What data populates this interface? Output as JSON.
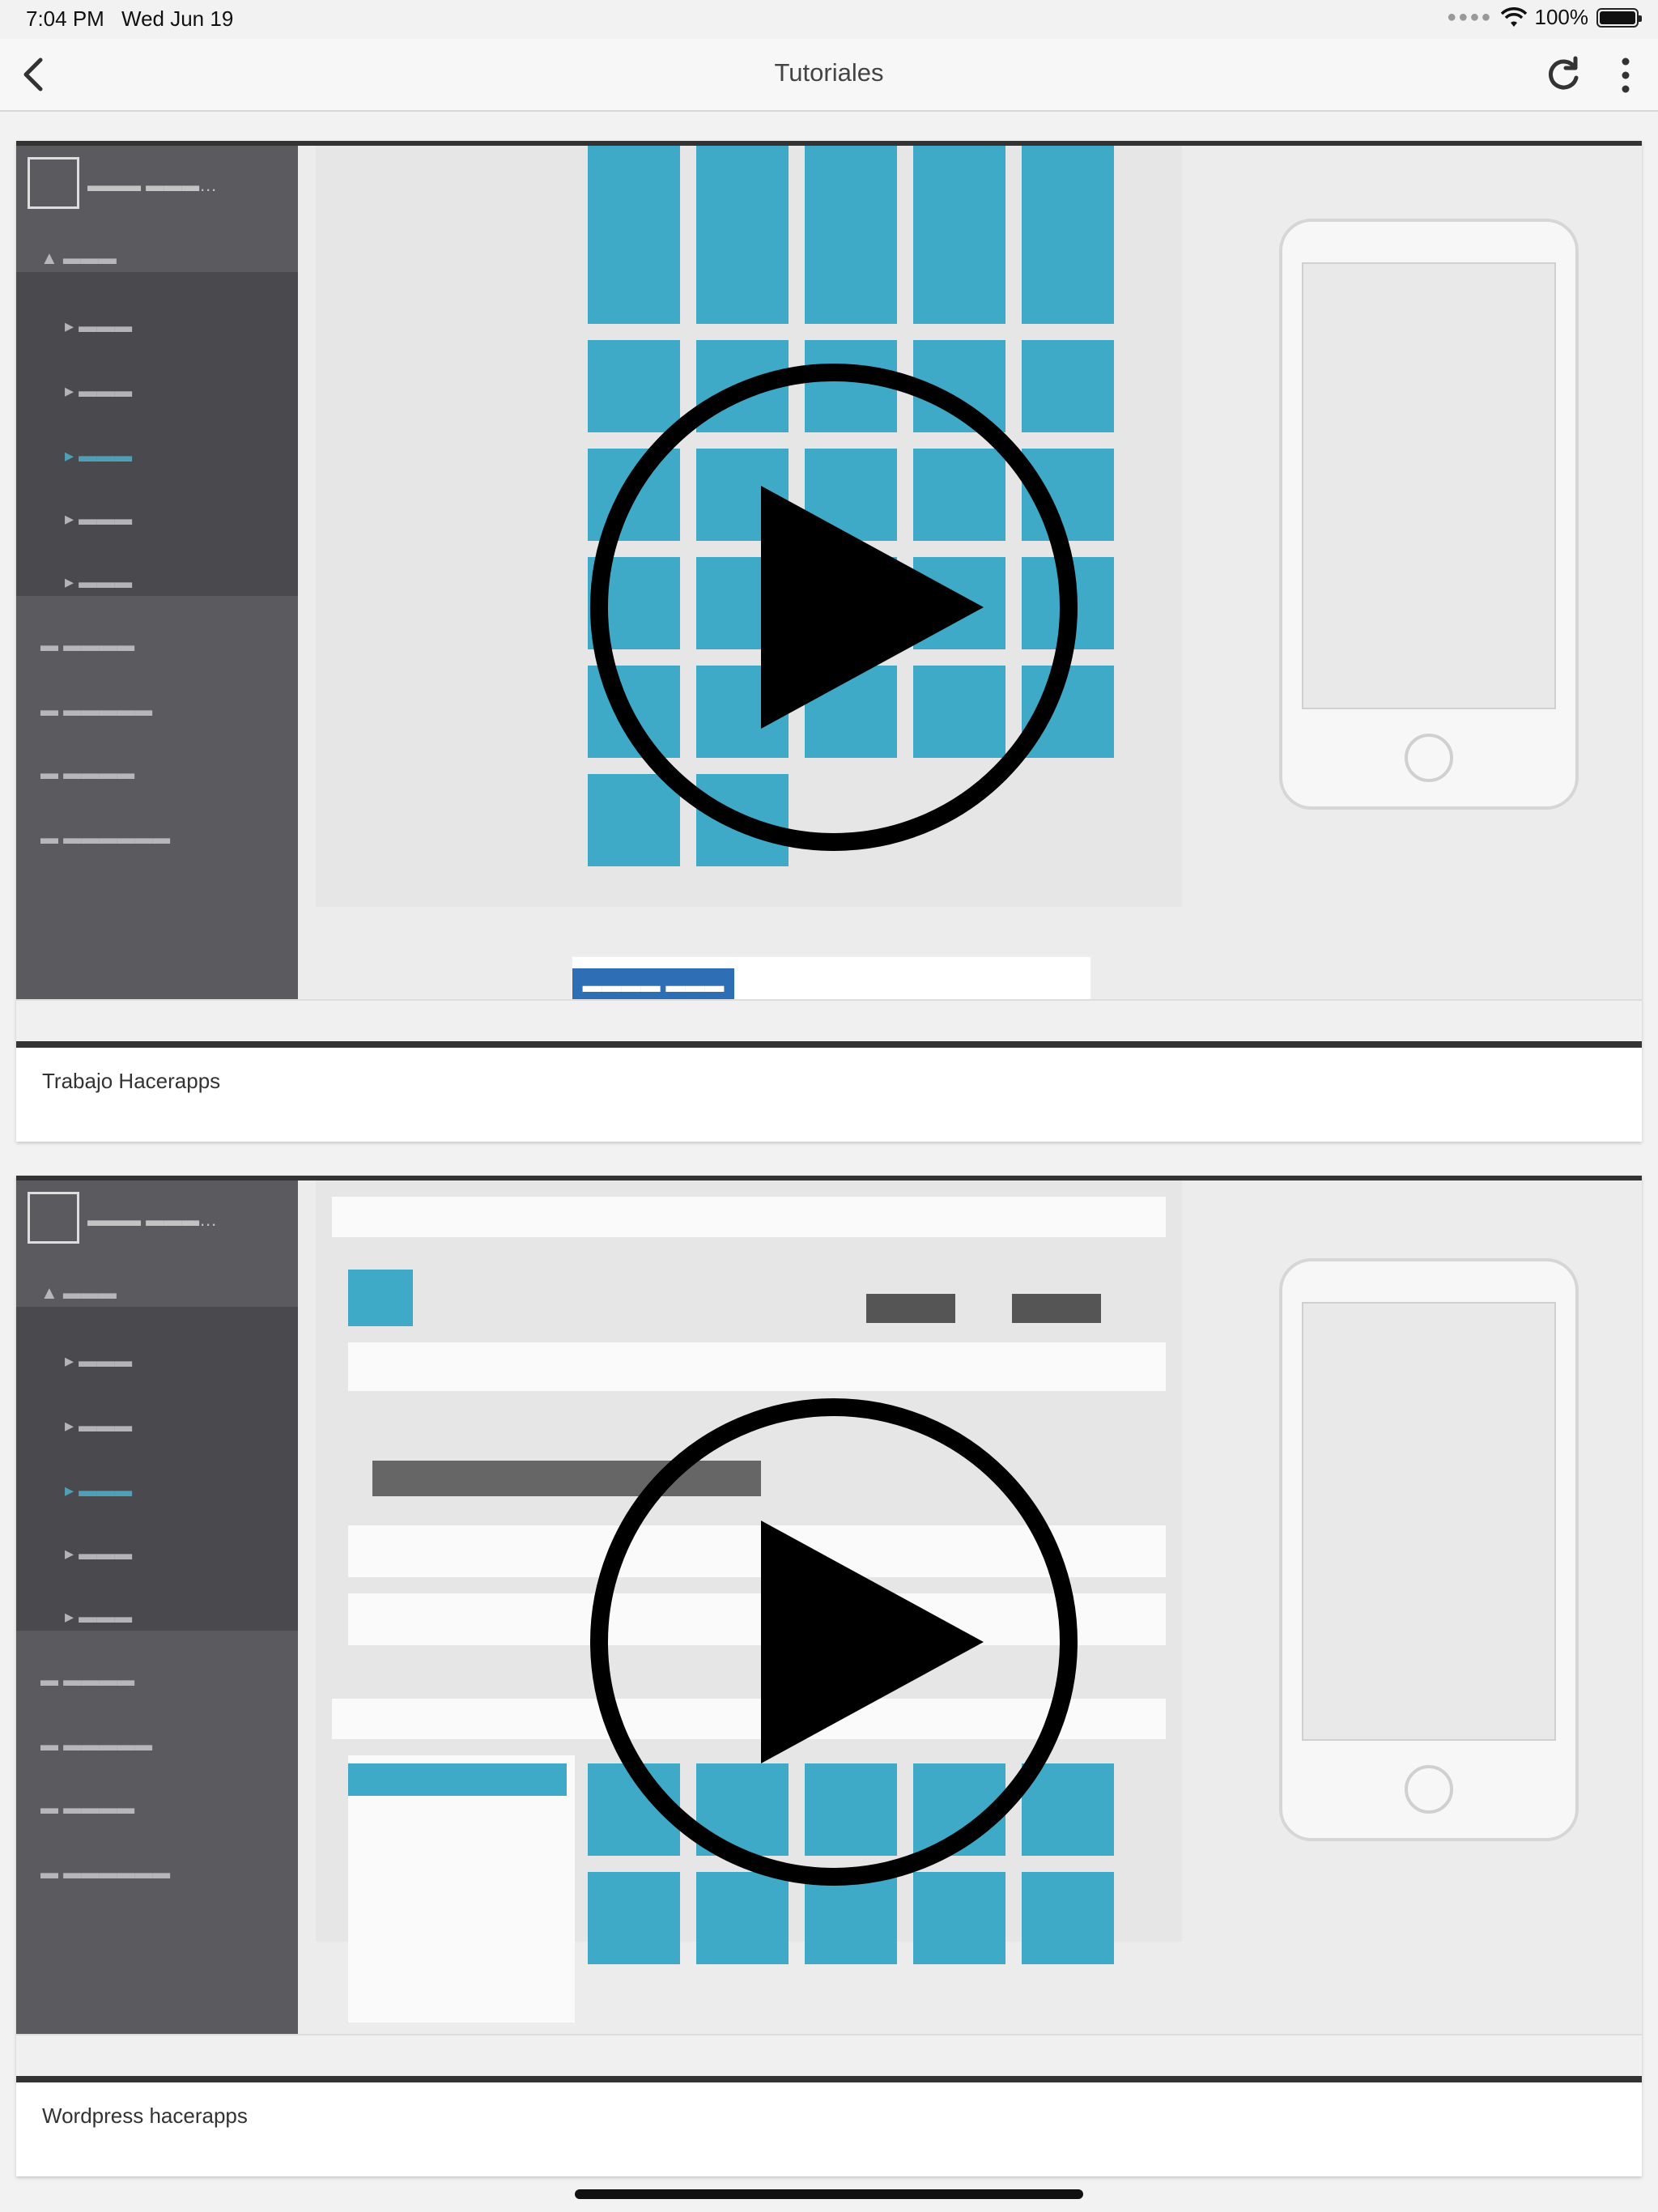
{
  "status_bar": {
    "time": "7:04 PM",
    "date": "Wed Jun 19",
    "battery": "100%"
  },
  "nav": {
    "title": "Tutoriales",
    "back_icon": "chevron-left-icon",
    "refresh_icon": "refresh-icon",
    "more_icon": "more-vertical-icon"
  },
  "videos": [
    {
      "caption": "Trabajo Hacerapps"
    },
    {
      "caption": "Wordpress hacerapps"
    }
  ],
  "colors": {
    "tile": "#3fa9c8",
    "sidebar": "#5b5b5f",
    "background": "#f2f2f2"
  }
}
